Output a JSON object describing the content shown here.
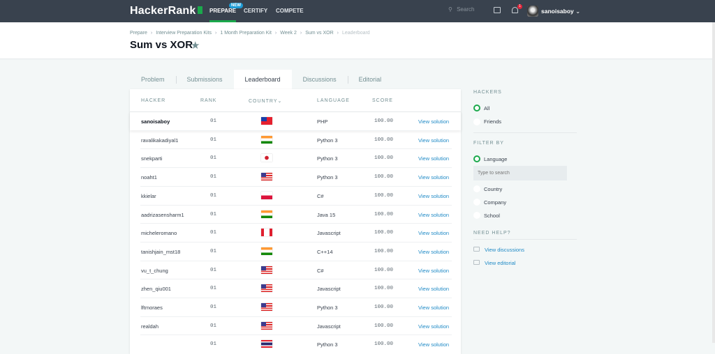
{
  "nav": {
    "logo": "HackerRank",
    "items": [
      "PREPARE",
      "CERTIFY",
      "COMPETE"
    ],
    "new_badge": "NEW",
    "search_placeholder": "Search",
    "notification_count": "1",
    "username": "sanoisaboy"
  },
  "breadcrumb": [
    "Prepare",
    "Interview Preparation Kits",
    "1 Month Preparation Kit",
    "Week 2",
    "Sum vs XOR",
    "Leaderboard"
  ],
  "page_title": "Sum vs XOR",
  "tabs": [
    "Problem",
    "Submissions",
    "Leaderboard",
    "Discussions",
    "Editorial"
  ],
  "active_tab": "Leaderboard",
  "table": {
    "headers": [
      "HACKER",
      "RANK",
      "COUNTRY",
      "LANGUAGE",
      "SCORE"
    ],
    "rows": [
      {
        "hacker": "sanoisaboy",
        "rank": "01",
        "country": "TW",
        "language": "PHP",
        "score": "100.00",
        "action": "View solution"
      },
      {
        "hacker": "ravalikakadiyal1",
        "rank": "01",
        "country": "IN",
        "language": "Python 3",
        "score": "100.00",
        "action": "View solution"
      },
      {
        "hacker": "snekparti",
        "rank": "01",
        "country": "JP",
        "language": "Python 3",
        "score": "100.00",
        "action": "View solution"
      },
      {
        "hacker": "noaht1",
        "rank": "01",
        "country": "US",
        "language": "Python 3",
        "score": "100.00",
        "action": "View solution"
      },
      {
        "hacker": "kkielar",
        "rank": "01",
        "country": "PL",
        "language": "C#",
        "score": "100.00",
        "action": "View solution"
      },
      {
        "hacker": "aadrizasensharm1",
        "rank": "01",
        "country": "IN",
        "language": "Java 15",
        "score": "100.00",
        "action": "View solution"
      },
      {
        "hacker": "micheleromano",
        "rank": "01",
        "country": "CA",
        "language": "Javascript",
        "score": "100.00",
        "action": "View solution"
      },
      {
        "hacker": "tanishjain_mst18",
        "rank": "01",
        "country": "IN",
        "language": "C++14",
        "score": "100.00",
        "action": "View solution"
      },
      {
        "hacker": "vu_t_chung",
        "rank": "01",
        "country": "US",
        "language": "C#",
        "score": "100.00",
        "action": "View solution"
      },
      {
        "hacker": "zhen_qiu001",
        "rank": "01",
        "country": "US",
        "language": "Javascript",
        "score": "100.00",
        "action": "View solution"
      },
      {
        "hacker": "lftmoraes",
        "rank": "01",
        "country": "US",
        "language": "Python 3",
        "score": "100.00",
        "action": "View solution"
      },
      {
        "hacker": "realdah",
        "rank": "01",
        "country": "US",
        "language": "Javascript",
        "score": "100.00",
        "action": "View solution"
      },
      {
        "hacker": "",
        "rank": "01",
        "country": "TH",
        "language": "Python 3",
        "score": "100.00",
        "action": "View solution"
      }
    ]
  },
  "sidebar": {
    "hackers_title": "HACKERS",
    "hackers_options": [
      "All",
      "Friends"
    ],
    "filter_title": "FILTER BY",
    "filter_options": [
      "Language",
      "Country",
      "Company",
      "School"
    ],
    "search_placeholder": "Type to search",
    "help_title": "NEED HELP?",
    "help_links": [
      "View discussions",
      "View editorial"
    ]
  },
  "colors": {
    "nav_bg": "#39424e",
    "accent_green": "#1ba94c",
    "link": "#1f8ac6"
  }
}
